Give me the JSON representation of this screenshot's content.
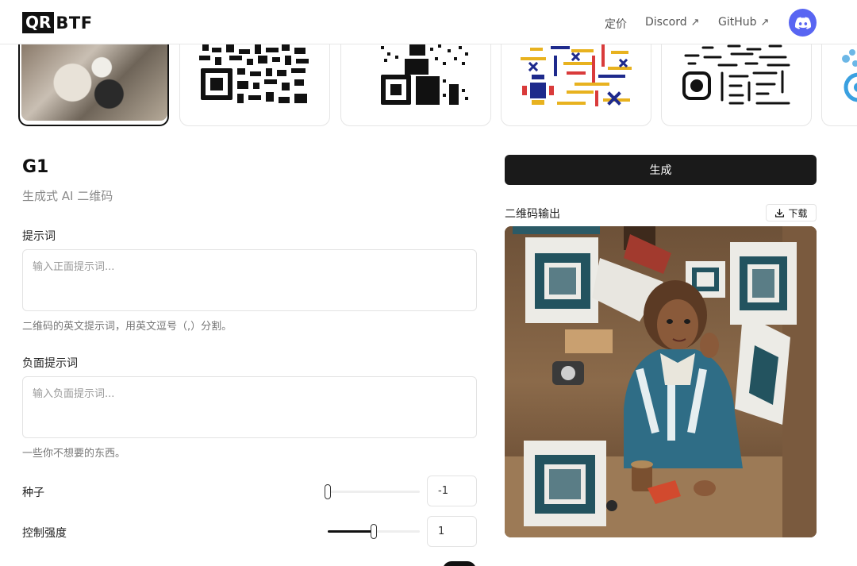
{
  "header": {
    "logo_box": "QR",
    "logo_text": "BTF",
    "nav": {
      "pricing": "定价",
      "discord": "Discord",
      "github": "GitHub",
      "arrow": "↗"
    },
    "avatar_icon": "discord-icon"
  },
  "gallery": {
    "items": [
      {
        "name": "g1-anime-thumbnail",
        "selected": true
      },
      {
        "name": "qr-style-blocks"
      },
      {
        "name": "qr-style-random-dots"
      },
      {
        "name": "qr-style-color-lines"
      },
      {
        "name": "qr-style-dash-lines"
      },
      {
        "name": "qr-style-partial-cut-off"
      }
    ]
  },
  "form": {
    "title": "G1",
    "subtitle": "生成式 AI 二维码",
    "prompt": {
      "label": "提示词",
      "placeholder": "输入正面提示词...",
      "hint": "二维码的英文提示词，用英文逗号（,）分割。"
    },
    "negative_prompt": {
      "label": "负面提示词",
      "placeholder": "输入负面提示词...",
      "hint": "一些你不想要的东西。"
    },
    "seed": {
      "label": "种子",
      "value": "-1",
      "level": 0
    },
    "control_strength": {
      "label": "控制强度",
      "value": "1",
      "level": 0.5
    }
  },
  "output": {
    "generate_label": "生成",
    "qr_output_label": "二维码输出",
    "download_label": "下载"
  },
  "colors": {
    "primary": "#111111",
    "discord": "#5865f2",
    "muted": "#8a8a8a"
  }
}
